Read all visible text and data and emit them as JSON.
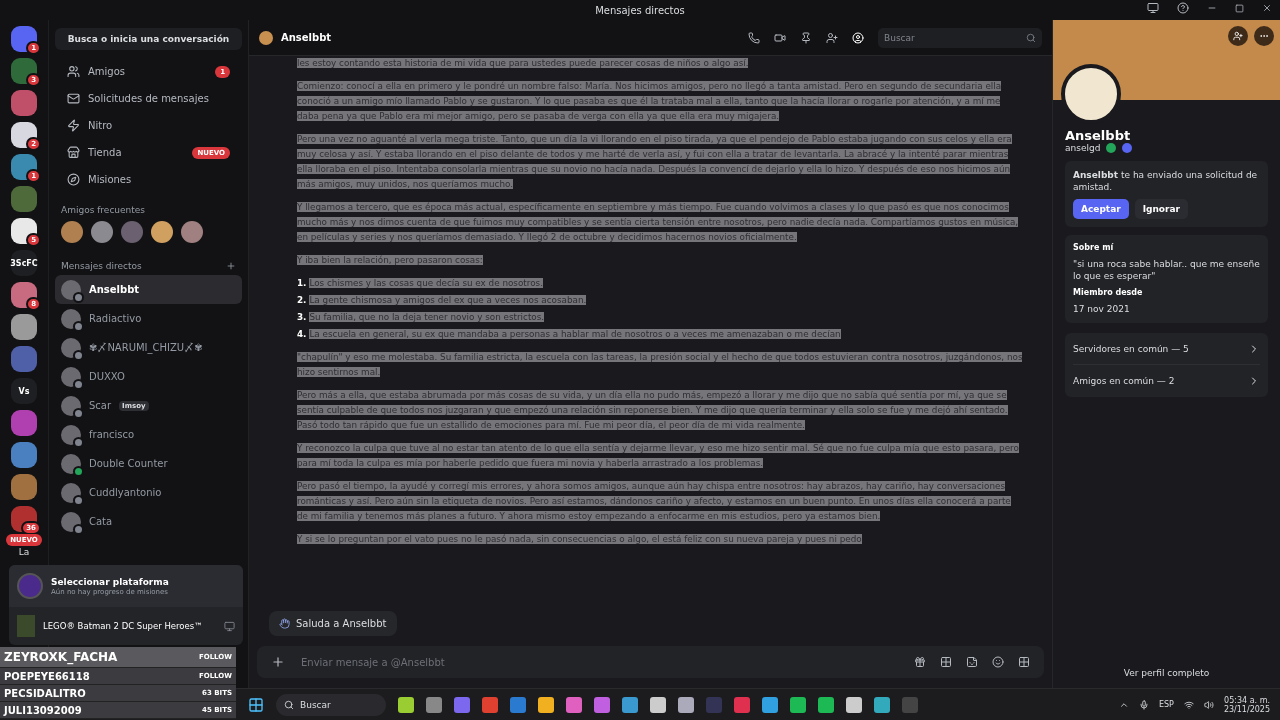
{
  "window": {
    "title": "Mensajes directos"
  },
  "servers": [
    {
      "badge": "1",
      "color": "#5865f2"
    },
    {
      "badge": "3",
      "color": "#2f6b3a"
    },
    {
      "color": "#c0506a"
    },
    {
      "badge": "2",
      "color": "#d8d8e0"
    },
    {
      "badge": "1",
      "color": "#3a8ab0"
    },
    {
      "color": "#4f6a3a"
    },
    {
      "badge": "5",
      "color": "#e8e8e8"
    },
    {
      "label": "3ScFC",
      "color": "#1e1f22"
    },
    {
      "badge": "8",
      "color": "#c86a80"
    },
    {
      "color": "#9a9a9a"
    },
    {
      "color": "#5060a8"
    },
    {
      "label": "Vs",
      "color": "#1e1f22"
    },
    {
      "color": "#b040b0"
    },
    {
      "color": "#4a80c0"
    },
    {
      "color": "#a07040"
    },
    {
      "badge": "36",
      "color": "#b03030"
    }
  ],
  "servers_new_pill": "NUEVO",
  "servers_cut_label": "La",
  "dm_search": "Busca o inicia una conversación",
  "nav": [
    {
      "kind": "friends",
      "label": "Amigos",
      "badge": "1"
    },
    {
      "kind": "mail",
      "label": "Solicitudes de mensajes"
    },
    {
      "kind": "nitro",
      "label": "Nitro"
    },
    {
      "kind": "shop",
      "label": "Tienda",
      "badge": "NUEVO"
    },
    {
      "kind": "quests",
      "label": "Misiones"
    }
  ],
  "frequent_friends": {
    "title": "Amigos frecuentes"
  },
  "dm_header": "Mensajes directos",
  "dms": [
    {
      "name": "Anselbbt",
      "selected": true,
      "color": "#80848e"
    },
    {
      "name": "Radiactivo",
      "selected": false,
      "color": "#80848e"
    },
    {
      "name": "✾〆NARUMI_CHIZU〆✾",
      "selected": false,
      "color": "#80848e"
    },
    {
      "name": "DUXXO",
      "selected": false,
      "color": "#80848e"
    },
    {
      "name": "Scar",
      "tag": "Imsoy",
      "selected": false,
      "color": "#80848e"
    },
    {
      "name": "francisco",
      "selected": false,
      "color": "#80848e"
    },
    {
      "name": "Double Counter",
      "selected": false,
      "color": "#23a55a"
    },
    {
      "name": "Cuddlyantonio",
      "selected": false,
      "color": "#80848e"
    },
    {
      "name": "Cata",
      "selected": false,
      "color": "#80848e"
    }
  ],
  "quest_popup": {
    "title": "Seleccionar plataforma",
    "subtitle": "Aún no hay progreso de misiones",
    "game": "LEGO® Batman 2 DC Super Heroes™"
  },
  "stream_alerts": [
    {
      "name": "ZEYROXK_FACHA",
      "action": "FOLLOW"
    },
    {
      "name": "POEPEYE66118",
      "action": "FOLLOW"
    },
    {
      "name": "PECSIDALITRO",
      "action": "63 BITS"
    },
    {
      "name": "JULI13092009",
      "action": "45 BITS"
    }
  ],
  "chat": {
    "title": "Anselbbt",
    "search": {
      "placeholder": "Buscar"
    },
    "blocks": [
      {
        "kind": "paragraph",
        "text": "les estoy contando esta historia de mi vida que para ustedes puede parecer cosas de niños o algo así."
      },
      {
        "kind": "paragraph",
        "text": "Comienzo: conocí a ella en primero y le pondré un nombre falso: María. Nos hicimos amigos, pero no llegó a tanta amistad. Pero en segundo de secundaria ella conoció a un amigo mío llamado Pablo y se gustaron. Y lo que pasaba es que él la trataba mal a ella, tanto que la hacía llorar o rogarle por atención, y a mí me daba pena ya que Pablo era mi mejor amigo, pero se pasaba de verga con ella ya que ella era muy migajera."
      },
      {
        "kind": "paragraph",
        "text": "Pero una vez no aguanté al verla mega triste. Tanto, que un día la vi llorando en el piso tirada, ya que el pendejo de Pablo estaba jugando con sus celos y ella era muy celosa y así. Y estaba llorando en el piso delante de todos y me harté de verla así, y fui con ella a tratar de levantarla. La abracé y la intenté parar mientras ella lloraba en el piso. Intentaba consolarla mientras que su novio no hacía nada. Después la convencí de dejarlo y ella lo hizo. Y después de eso nos hicimos aún más amigos, muy unidos, nos queríamos mucho."
      },
      {
        "kind": "paragraph",
        "text": "Y llegamos a tercero, que es época más actual, específicamente en septiembre y más tiempo. Fue cuando volvimos a clases y lo que pasó es que nos conocimos mucho más y nos dimos cuenta de que fuimos muy compatibles y se sentía cierta tensión entre nosotros, pero nadie decía nada. Compartíamos gustos en música, en películas y series y nos queríamos demasiado. Y llegó 2 de octubre y decidimos hacernos novios oficialmente."
      },
      {
        "kind": "paragraph",
        "text": "Y iba bien la relación, pero pasaron cosas:"
      },
      {
        "kind": "list",
        "items": [
          {
            "marker": "1.",
            "text": "Los chismes y las cosas que decía su ex de nosotros."
          },
          {
            "marker": "2.",
            "text": "La gente chismosa y amigos del ex que a veces nos acosaban."
          },
          {
            "marker": "3.",
            "text": "Su familia, que no la deja tener novio y son estrictos."
          },
          {
            "marker": "4.",
            "text": "La escuela en general, su ex que mandaba a personas a hablar mal de nosotros o a veces me amenazaban o me decían"
          }
        ]
      },
      {
        "kind": "paragraph",
        "text": "\"chapulín\" y eso me molestaba. Su familia estricta, la escuela con las tareas, la presión social y el hecho de que todos estuvieran contra nosotros, juzgándonos, nos hizo sentirnos mal."
      },
      {
        "kind": "paragraph",
        "text": "Pero más a ella, que estaba abrumada por más cosas de su vida, y un día ella no pudo más, empezó a llorar y me dijo que no sabía qué sentía por mí, ya que se sentía culpable de que todos nos juzgaran y que empezó una relación sin reponerse bien. Y me dijo que quería terminar y ella solo se fue y me dejó ahí sentado. Pasó todo tan rápido que fue un estallido de emociones para mí. Fue mi peor día, el peor día de mi vida realmente."
      },
      {
        "kind": "paragraph",
        "text": "Y reconozco la culpa que tuve al no estar tan atento de lo que ella sentía y dejarme llevar, y eso me hizo sentir mal. Sé que no fue culpa mía que esto pasara, pero para mí toda la culpa es mía por haberle pedido que fuera mi novia y haberla arrastrado a los problemas."
      },
      {
        "kind": "paragraph",
        "text": "Pero pasó el tiempo, la ayudé y corregí mis errores, y ahora somos amigos, aunque aún hay chispa entre nosotros: hay abrazos, hay cariño, hay conversaciones románticas y así. Pero aún sin la etiqueta de novios. Pero así estamos, dándonos cariño y afecto, y estamos en un buen punto. En unos días ella conocerá a parte de mi familia y tenemos más planes a futuro. Y ahora mismo estoy empezando a enfocarme en mis estudios, pero ya estamos bien."
      },
      {
        "kind": "tight",
        "text": "Y si se lo preguntan por el vato pues no le pasó nada, sin consecuencias o algo, el está feliz con su nueva pareja y pues ni pedo"
      }
    ],
    "wave_button": "Saluda a Anselbbt",
    "composer": {
      "placeholder": "Enviar mensaje a @Anselbbt"
    }
  },
  "profile": {
    "name": "Anselbbt",
    "username": "anselgd",
    "request": {
      "sender": "Anselbbt",
      "text": " te ha enviado una solicitud de amistad.",
      "accept": "Aceptar",
      "ignore": "Ignorar"
    },
    "about_title": "Sobre mí",
    "about": "\"si una roca sabe hablar.. que me enseñe lo que es esperar\"",
    "member_title": "Miembro desde",
    "member_since": "17 nov 2021",
    "mutual": [
      "Servidores en común — 5",
      "Amigos en común — 2"
    ],
    "full_profile": "Ver perfil completo"
  },
  "taskbar": {
    "search": "Buscar",
    "lang": "ESP",
    "time": "05:34 a. m.",
    "date": "23/11/2025"
  }
}
